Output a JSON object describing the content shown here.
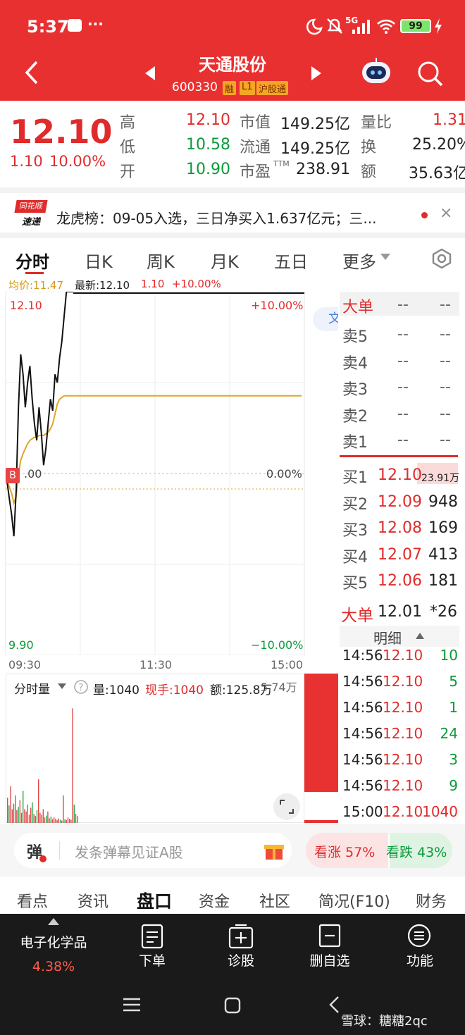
{
  "status": {
    "time": "5:37",
    "dots": "···",
    "signal": "5G",
    "battery": "99"
  },
  "header": {
    "title": "天通股份",
    "code": "600330",
    "badges": [
      "融",
      "L1",
      "沪股通"
    ]
  },
  "quote": {
    "price": "12.10",
    "change": "1.10",
    "pct": "10.00%",
    "high_label": "高",
    "high": "12.10",
    "low_label": "低",
    "low": "10.58",
    "open_label": "开",
    "open": "10.90",
    "mcap_label": "市值",
    "mcap": "149.25亿",
    "float_label": "流通",
    "float": "149.25亿",
    "pe_label": "市盈",
    "pe_sup": "TTM",
    "pe": "238.91",
    "vr_label": "量比",
    "vr": "1.31",
    "turn_label": "换",
    "turn": "25.20%",
    "amt_label": "额",
    "amt": "35.63亿"
  },
  "news": {
    "logo_top": "同花顺",
    "logo_bottom": "速递",
    "text": "龙虎榜：09-05入选，三日净买入1.637亿元；三...",
    "close": "×"
  },
  "tabs": [
    "分时",
    "日K",
    "周K",
    "月K",
    "五日",
    "更多"
  ],
  "chart": {
    "avg_label": "均价:11.47",
    "latest_label": "最新:12.10",
    "latest_change": "1.10",
    "latest_pct": "+10.00%",
    "y_top": "12.10",
    "y_bottom": "9.90",
    "pct_top": "+10.00%",
    "pct_mid": "0.00%",
    "pct_bottom": "−10.00%",
    "mid_left": ".00",
    "b_marker": "B",
    "x_labels": [
      "09:30",
      "11:30",
      "15:00"
    ],
    "wen": "文",
    "prices": [
      10.95,
      10.85,
      10.75,
      10.62,
      10.9,
      11.4,
      11.72,
      11.6,
      11.4,
      11.55,
      11.65,
      11.45,
      11.3,
      11.2,
      11.4,
      11.25,
      11.05,
      11.15,
      11.3,
      11.45,
      11.38,
      11.6,
      11.55,
      11.7,
      11.8,
      11.95,
      12.1,
      12.1,
      12.1,
      12.1
    ],
    "avg": [
      10.95,
      10.92,
      10.88,
      10.82,
      10.86,
      11.0,
      11.08,
      11.12,
      11.15,
      11.18,
      11.2,
      11.21,
      11.22,
      11.22,
      11.23,
      11.23,
      11.23,
      11.24,
      11.25,
      11.27,
      11.3,
      11.36,
      11.42,
      11.45,
      11.46,
      11.47,
      11.47,
      11.47,
      11.47,
      11.47
    ]
  },
  "volume": {
    "label": "分时量",
    "vol": "量:1040",
    "hand": "现手:1040",
    "amount": "额:125.8万",
    "max": "5.74万",
    "bars": [
      55,
      38,
      80,
      30,
      42,
      60,
      28,
      35,
      50,
      22,
      70,
      30,
      25,
      40,
      18,
      33,
      45,
      20,
      15,
      28,
      95,
      22,
      18,
      30,
      12,
      16,
      25,
      10,
      14,
      8,
      12,
      9,
      6,
      10,
      7,
      5,
      60,
      8,
      6,
      12,
      9,
      7,
      250,
      40,
      20,
      15
    ]
  },
  "orderbook": {
    "big_label": "大单",
    "dash": "--",
    "sell": [
      {
        "l": "卖5"
      },
      {
        "l": "卖4"
      },
      {
        "l": "卖3"
      },
      {
        "l": "卖2"
      },
      {
        "l": "卖1"
      }
    ],
    "buy": [
      {
        "l": "买1",
        "p": "12.10",
        "v": "23.91万"
      },
      {
        "l": "买2",
        "p": "12.09",
        "v": "948"
      },
      {
        "l": "买3",
        "p": "12.08",
        "v": "169"
      },
      {
        "l": "买4",
        "p": "12.07",
        "v": "413"
      },
      {
        "l": "买5",
        "p": "12.06",
        "v": "181"
      }
    ],
    "big_bottom_label": "大单",
    "big_bottom_price": "12.01",
    "big_bottom_vol": "*26"
  },
  "detail": {
    "title": "明细",
    "rows": [
      {
        "t": "14:56",
        "p": "12.10",
        "v": "10"
      },
      {
        "t": "14:56",
        "p": "12.10",
        "v": "5"
      },
      {
        "t": "14:56",
        "p": "12.10",
        "v": "1"
      },
      {
        "t": "14:56",
        "p": "12.10",
        "v": "24"
      },
      {
        "t": "14:56",
        "p": "12.10",
        "v": "3"
      },
      {
        "t": "14:56",
        "p": "12.10",
        "v": "9"
      },
      {
        "t": "15:00",
        "p": "12.10",
        "v": "1040"
      }
    ]
  },
  "danmu": {
    "icon": "弹",
    "placeholder": "发条弹幕见证A股",
    "up": "看涨 57%",
    "down": "看跌 43%",
    "up_pct": 57
  },
  "bottom_tabs": [
    "看点",
    "资讯",
    "盘口",
    "资金",
    "社区",
    "简况(F10)",
    "财务"
  ],
  "nav": {
    "sector": "电子化学品",
    "sector_pct": "4.38%",
    "items": [
      "下单",
      "诊股",
      "删自选",
      "功能"
    ]
  },
  "watermark": "雪球：糖糖2qc"
}
